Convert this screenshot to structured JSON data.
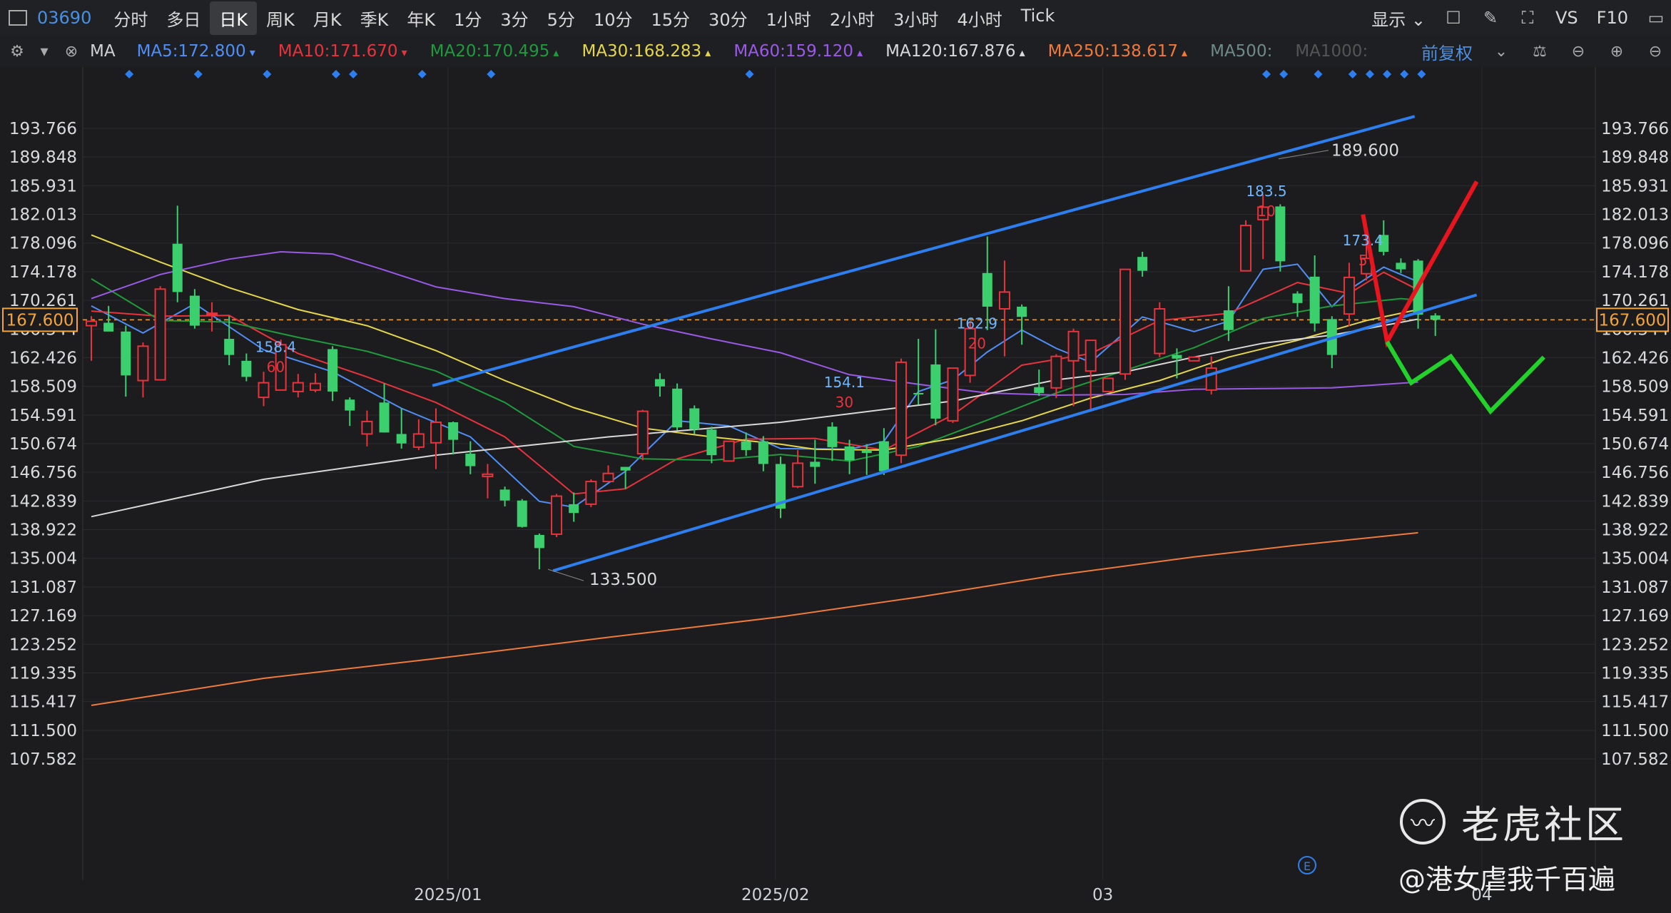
{
  "toolbar": {
    "symbol": "03690",
    "tabs": [
      "分时",
      "多日",
      "日K",
      "周K",
      "月K",
      "季K",
      "年K",
      "1分",
      "3分",
      "5分",
      "10分",
      "15分",
      "30分",
      "1小时",
      "2小时",
      "3小时",
      "4小时",
      "Tick"
    ],
    "active_tab": "日K",
    "display_label": "显示",
    "vs_label": "VS",
    "f10_label": "F10"
  },
  "ma_bar": {
    "label": "MA",
    "items": [
      {
        "text": "MA5:172.800",
        "color": "#4f8ff7",
        "arrow": "down"
      },
      {
        "text": "MA10:171.670",
        "color": "#e8333c",
        "arrow": "down"
      },
      {
        "text": "MA20:170.495",
        "color": "#1f9a3c",
        "arrow": "up"
      },
      {
        "text": "MA30:168.283",
        "color": "#e6d64a",
        "arrow": "up"
      },
      {
        "text": "MA60:159.120",
        "color": "#9b59e8",
        "arrow": "up"
      },
      {
        "text": "MA120:167.876",
        "color": "#d9d9d9",
        "arrow": "up"
      },
      {
        "text": "MA250:138.617",
        "color": "#f07a3a",
        "arrow": "up"
      },
      {
        "text": "MA500:",
        "color": "#6f8a8a",
        "arrow": ""
      },
      {
        "text": "MA1000:",
        "color": "#555555",
        "arrow": ""
      }
    ],
    "adjust_label": "前复权"
  },
  "chart_data": {
    "type": "candlestick",
    "price_axis_labels": [
      "193.766",
      "189.848",
      "185.931",
      "182.013",
      "178.096",
      "174.178",
      "170.261",
      "166.344",
      "162.426",
      "158.509",
      "154.591",
      "150.674",
      "146.756",
      "142.839",
      "138.922",
      "135.004",
      "131.087",
      "127.169",
      "123.252",
      "119.335",
      "115.417",
      "111.500",
      "107.582"
    ],
    "ylim": [
      106.0,
      196.5
    ],
    "current_price": "167.600",
    "date_labels": [
      {
        "label": "2025/01",
        "index": 20.7
      },
      {
        "label": "2025/02",
        "index": 39.7
      },
      {
        "label": "03",
        "index": 58.7
      },
      {
        "label": "04",
        "index": 80.7
      }
    ],
    "candles": [
      [
        166.8,
        168.1,
        162.0,
        167.4
      ],
      [
        167.2,
        169.5,
        166.2,
        166.0
      ],
      [
        166.0,
        166.8,
        157.1,
        160.0
      ],
      [
        159.3,
        164.5,
        157.0,
        164.0
      ],
      [
        159.4,
        172.2,
        159.4,
        171.8
      ],
      [
        178.0,
        183.2,
        170.0,
        171.4
      ],
      [
        170.9,
        171.8,
        166.4,
        166.8
      ],
      [
        168.5,
        170.0,
        166.0,
        168.5
      ],
      [
        165.0,
        168.1,
        161.4,
        162.8
      ],
      [
        162.0,
        163.0,
        159.2,
        159.8
      ],
      [
        157.0,
        160.5,
        155.8,
        159.0
      ],
      [
        158.0,
        164.9,
        158.0,
        164.2
      ],
      [
        157.8,
        160.2,
        157.0,
        159.0
      ],
      [
        158.0,
        160.3,
        157.7,
        158.9
      ],
      [
        163.6,
        164.0,
        156.5,
        157.8
      ],
      [
        156.7,
        157.0,
        153.1,
        155.2
      ],
      [
        152.0,
        155.2,
        150.3,
        153.7
      ],
      [
        156.3,
        158.9,
        152.2,
        152.2
      ],
      [
        152.0,
        155.5,
        150.0,
        150.7
      ],
      [
        150.2,
        154.0,
        149.8,
        152.0
      ],
      [
        150.8,
        155.5,
        147.2,
        153.6
      ],
      [
        153.6,
        153.7,
        149.2,
        151.2
      ],
      [
        149.3,
        151.0,
        146.5,
        147.6
      ],
      [
        146.2,
        147.9,
        143.2,
        146.5
      ],
      [
        144.4,
        144.8,
        142.1,
        142.9
      ],
      [
        142.9,
        143.1,
        139.2,
        139.3
      ],
      [
        138.2,
        138.4,
        133.5,
        136.4
      ],
      [
        138.3,
        143.8,
        137.9,
        143.5
      ],
      [
        142.4,
        144.0,
        140.0,
        141.2
      ],
      [
        142.4,
        145.8,
        142.0,
        145.5
      ],
      [
        145.5,
        147.7,
        145.5,
        146.6
      ],
      [
        147.5,
        147.5,
        144.5,
        147.0
      ],
      [
        149.3,
        155.3,
        148.4,
        155.1
      ],
      [
        159.5,
        160.3,
        157.1,
        158.5
      ],
      [
        158.2,
        158.9,
        152.5,
        152.9
      ],
      [
        155.5,
        155.9,
        152.0,
        152.6
      ],
      [
        152.6,
        153.0,
        148.0,
        149.1
      ],
      [
        148.3,
        151.0,
        148.3,
        151.0
      ],
      [
        151.0,
        152.2,
        149.0,
        149.8
      ],
      [
        151.0,
        151.7,
        146.9,
        147.9
      ],
      [
        147.9,
        148.9,
        140.5,
        141.8
      ],
      [
        144.8,
        149.8,
        144.6,
        148.0
      ],
      [
        148.2,
        151.2,
        145.2,
        147.5
      ],
      [
        153.0,
        153.6,
        148.3,
        150.2
      ],
      [
        150.3,
        151.2,
        146.5,
        148.4
      ],
      [
        149.8,
        150.6,
        146.4,
        149.4
      ],
      [
        151.0,
        152.8,
        146.4,
        146.9
      ],
      [
        149.1,
        162.3,
        148.0,
        161.8
      ],
      [
        157.6,
        165.0,
        156.0,
        157.5
      ],
      [
        161.5,
        166.3,
        153.2,
        154.1
      ],
      [
        153.8,
        161.0,
        153.5,
        161.0
      ],
      [
        160.0,
        167.4,
        159.0,
        166.4
      ],
      [
        174.0,
        179.0,
        166.2,
        169.4
      ],
      [
        169.1,
        175.7,
        162.6,
        171.4
      ],
      [
        169.4,
        169.7,
        164.2,
        168.0
      ],
      [
        158.4,
        160.8,
        157.2,
        157.6
      ],
      [
        158.3,
        162.9,
        156.9,
        162.6
      ],
      [
        162.0,
        166.4,
        155.8,
        166.0
      ],
      [
        160.6,
        161.7,
        155.2,
        164.8
      ],
      [
        157.8,
        159.4,
        157.8,
        159.6
      ],
      [
        160.2,
        174.5,
        159.4,
        174.5
      ],
      [
        176.2,
        176.9,
        173.5,
        174.3
      ],
      [
        163.0,
        170.0,
        162.5,
        169.1
      ],
      [
        162.8,
        163.7,
        159.6,
        162.3
      ],
      [
        162.0,
        162.1,
        162.2,
        162.5
      ],
      [
        158.0,
        162.6,
        157.4,
        161.0
      ],
      [
        168.9,
        172.2,
        164.7,
        166.2
      ],
      [
        174.3,
        181.2,
        174.3,
        180.5
      ],
      [
        181.3,
        184.7,
        175.9,
        183.0
      ],
      [
        183.1,
        183.4,
        174.2,
        175.6
      ],
      [
        171.2,
        171.5,
        168.0,
        169.9
      ],
      [
        173.5,
        176.4,
        166.0,
        167.1
      ],
      [
        167.7,
        168.1,
        161.0,
        162.8
      ],
      [
        168.4,
        175.4,
        166.7,
        173.4
      ],
      [
        173.9,
        178.3,
        173.0,
        176.0
      ],
      [
        179.2,
        181.2,
        176.4,
        176.9
      ],
      [
        175.4,
        176.0,
        174.0,
        174.5
      ],
      [
        175.7,
        175.9,
        166.4,
        168.3
      ],
      [
        168.2,
        168.5,
        165.4,
        167.6
      ]
    ],
    "ma_series": [
      {
        "name": "MA5",
        "color": "#4f8ff7",
        "points": [
          [
            0,
            169.5
          ],
          [
            3,
            165.8
          ],
          [
            6,
            169.8
          ],
          [
            10,
            163.5
          ],
          [
            14,
            160.5
          ],
          [
            18,
            155.5
          ],
          [
            22,
            151.6
          ],
          [
            26,
            142.8
          ],
          [
            28,
            142.0
          ],
          [
            31,
            146.9
          ],
          [
            34,
            153.8
          ],
          [
            37,
            153.1
          ],
          [
            40,
            150.0
          ],
          [
            44,
            149.9
          ],
          [
            46,
            151.0
          ],
          [
            48,
            157.8
          ],
          [
            50,
            159.4
          ],
          [
            52,
            163.2
          ],
          [
            54,
            166.2
          ],
          [
            56,
            163.7
          ],
          [
            58,
            161.8
          ],
          [
            61,
            168.0
          ],
          [
            64,
            166.0
          ],
          [
            66,
            167.4
          ],
          [
            68,
            174.5
          ],
          [
            70,
            175.2
          ],
          [
            72,
            169.4
          ],
          [
            73,
            171.7
          ],
          [
            75,
            174.8
          ],
          [
            77,
            172.8
          ]
        ]
      },
      {
        "name": "MA10",
        "color": "#e8333c",
        "points": [
          [
            0,
            168.8
          ],
          [
            4,
            168.1
          ],
          [
            8,
            168.2
          ],
          [
            12,
            163.0
          ],
          [
            16,
            159.8
          ],
          [
            20,
            156.3
          ],
          [
            24,
            151.6
          ],
          [
            28,
            143.8
          ],
          [
            31,
            144.5
          ],
          [
            34,
            148.6
          ],
          [
            38,
            151.3
          ],
          [
            42,
            151.4
          ],
          [
            46,
            149.8
          ],
          [
            50,
            154.6
          ],
          [
            54,
            161.4
          ],
          [
            58,
            163.0
          ],
          [
            62,
            167.5
          ],
          [
            66,
            168.5
          ],
          [
            70,
            172.7
          ],
          [
            73,
            171.2
          ],
          [
            75,
            174.1
          ],
          [
            77,
            171.7
          ]
        ]
      },
      {
        "name": "MA20",
        "color": "#1f9a3c",
        "points": [
          [
            0,
            173.2
          ],
          [
            4,
            167.5
          ],
          [
            8,
            167.3
          ],
          [
            12,
            165.2
          ],
          [
            16,
            163.3
          ],
          [
            20,
            160.6
          ],
          [
            24,
            156.3
          ],
          [
            28,
            150.3
          ],
          [
            32,
            148.6
          ],
          [
            36,
            148.4
          ],
          [
            40,
            149.2
          ],
          [
            44,
            148.3
          ],
          [
            48,
            150.3
          ],
          [
            52,
            153.9
          ],
          [
            56,
            157.6
          ],
          [
            60,
            160.7
          ],
          [
            64,
            163.8
          ],
          [
            68,
            167.8
          ],
          [
            72,
            169.5
          ],
          [
            76,
            170.5
          ],
          [
            77,
            170.3
          ]
        ]
      },
      {
        "name": "MA30",
        "color": "#e6d64a",
        "points": [
          [
            0,
            179.2
          ],
          [
            4,
            175.5
          ],
          [
            8,
            172.0
          ],
          [
            12,
            169.0
          ],
          [
            16,
            166.8
          ],
          [
            20,
            163.4
          ],
          [
            24,
            159.3
          ],
          [
            28,
            155.6
          ],
          [
            32,
            152.8
          ],
          [
            36,
            151.6
          ],
          [
            40,
            150.6
          ],
          [
            42,
            149.9
          ],
          [
            46,
            149.8
          ],
          [
            50,
            151.4
          ],
          [
            54,
            153.8
          ],
          [
            58,
            156.9
          ],
          [
            62,
            159.3
          ],
          [
            66,
            162.5
          ],
          [
            70,
            164.8
          ],
          [
            74,
            167.5
          ],
          [
            77,
            169.0
          ]
        ]
      },
      {
        "name": "MA60",
        "color": "#9b59e8",
        "points": [
          [
            0,
            170.5
          ],
          [
            4,
            173.8
          ],
          [
            8,
            175.9
          ],
          [
            11,
            176.9
          ],
          [
            14,
            176.6
          ],
          [
            17,
            174.4
          ],
          [
            20,
            172.1
          ],
          [
            24,
            170.5
          ],
          [
            28,
            169.4
          ],
          [
            32,
            167.0
          ],
          [
            36,
            165.0
          ],
          [
            40,
            163.1
          ],
          [
            44,
            160.1
          ],
          [
            48,
            158.8
          ],
          [
            52,
            157.6
          ],
          [
            56,
            157.3
          ],
          [
            60,
            157.4
          ],
          [
            64,
            158.1
          ],
          [
            68,
            158.2
          ],
          [
            72,
            158.3
          ],
          [
            77,
            159.1
          ]
        ]
      },
      {
        "name": "MA120",
        "color": "#d9d9d9",
        "points": [
          [
            0,
            140.7
          ],
          [
            10,
            145.8
          ],
          [
            20,
            149.1
          ],
          [
            30,
            151.6
          ],
          [
            40,
            153.6
          ],
          [
            50,
            156.5
          ],
          [
            56,
            159.4
          ],
          [
            60,
            160.5
          ],
          [
            64,
            162.5
          ],
          [
            68,
            164.4
          ],
          [
            72,
            165.5
          ],
          [
            77,
            167.7
          ]
        ]
      },
      {
        "name": "MA250",
        "color": "#f07a3a",
        "points": [
          [
            0,
            114.9
          ],
          [
            10,
            118.6
          ],
          [
            20,
            121.3
          ],
          [
            30,
            124.2
          ],
          [
            40,
            127.0
          ],
          [
            48,
            129.7
          ],
          [
            56,
            132.7
          ],
          [
            64,
            135.2
          ],
          [
            70,
            136.8
          ],
          [
            77,
            138.5
          ]
        ]
      }
    ],
    "annotations": [
      {
        "idx": 68.2,
        "price": 184.5,
        "value": "183.5",
        "count": "10"
      },
      {
        "idx": 73.8,
        "price": 177.8,
        "value": "173.4",
        "count": "5"
      },
      {
        "idx": 51.4,
        "price": 166.4,
        "value": "162.9",
        "count": "20"
      },
      {
        "idx": 10.7,
        "price": 163.2,
        "value": "158.4",
        "count": "60"
      },
      {
        "idx": 43.7,
        "price": 158.4,
        "value": "154.1",
        "count": "30"
      }
    ],
    "high_label": {
      "idx": 68.9,
      "price": 189.6,
      "text": "189.600"
    },
    "low_label": {
      "idx": 26.5,
      "price": 133.5,
      "text": "133.500"
    },
    "trend_lines": [
      {
        "from": [
          19.8,
          158.6
        ],
        "to": [
          76.8,
          195.4
        ],
        "color": "#2d7ff0"
      },
      {
        "from": [
          26.8,
          133.3
        ],
        "to": [
          80.4,
          171.0
        ],
        "color": "#2d7ff0"
      }
    ],
    "drawings": [
      {
        "color": "#e8141e",
        "points": [
          [
            73.8,
            182.0
          ],
          [
            75.2,
            164.6
          ],
          [
            80.4,
            186.5
          ]
        ]
      },
      {
        "color": "#22d22b",
        "points": [
          [
            75.2,
            164.6
          ],
          [
            76.6,
            159.0
          ],
          [
            78.9,
            162.6
          ],
          [
            81.2,
            155.1
          ],
          [
            84.3,
            162.5
          ]
        ]
      }
    ],
    "event_markers": [
      2.2,
      6.2,
      10.2,
      14.2,
      15.2,
      19.2,
      23.2,
      38.2,
      68.2,
      69.2,
      71.2,
      73.2,
      74.2,
      75.2,
      76.2,
      77.2
    ]
  },
  "watermark": {
    "brand": "老虎社区",
    "author": "@港女虐我千百遍"
  }
}
